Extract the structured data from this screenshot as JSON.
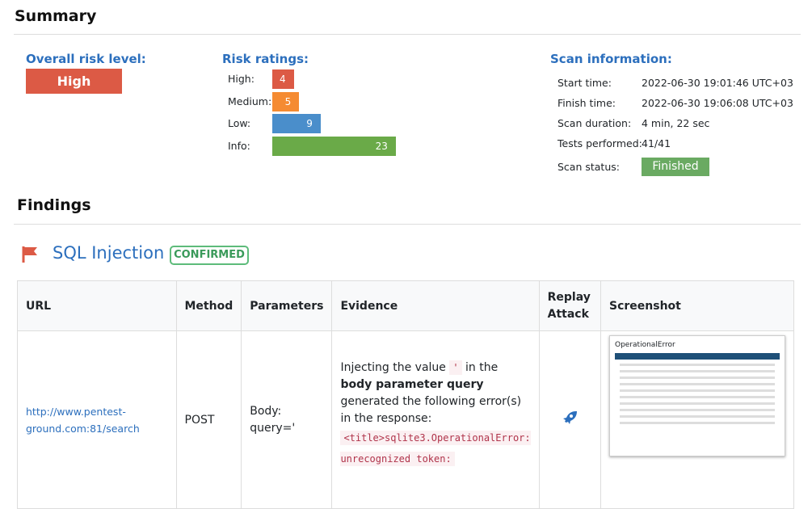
{
  "summary": {
    "title": "Summary",
    "overall_label": "Overall risk level:",
    "overall_value": "High",
    "ratings_label": "Risk ratings:",
    "ratings": [
      {
        "label": "High:",
        "value": 4,
        "color": "#dc5a45"
      },
      {
        "label": "Medium:",
        "value": 5,
        "color": "#f58b32"
      },
      {
        "label": "Low:",
        "value": 9,
        "color": "#4a8ecb"
      },
      {
        "label": "Info:",
        "value": 23,
        "color": "#6aaa48"
      }
    ],
    "scan_label": "Scan information:",
    "scan": [
      {
        "label": "Start time:",
        "value": "2022-06-30 19:01:46 UTC+03"
      },
      {
        "label": "Finish time:",
        "value": "2022-06-30 19:06:08 UTC+03"
      },
      {
        "label": "Scan duration:",
        "value": "4 min, 22 sec"
      },
      {
        "label": "Tests performed:",
        "value": "41/41"
      },
      {
        "label": "Scan status:",
        "value": "Finished"
      }
    ]
  },
  "findings": {
    "title": "Findings",
    "vuln": "SQL Injection",
    "badge": "CONFIRMED",
    "columns": [
      "URL",
      "Method",
      "Parameters",
      "Evidence",
      "Replay Attack",
      "Screenshot"
    ],
    "row": {
      "url": "http://www.pentest-ground.com:81/search",
      "method": "POST",
      "params": "Body: query='",
      "ev1": "Injecting the value ",
      "ev_code": "'",
      "ev2": " in the ",
      "ev_bold": "body parameter query",
      "ev3": " generated the following error(s) in the response:",
      "ev_error": "<title>sqlite3.OperationalError: unrecognized token:",
      "shot_title": "OperationalError"
    }
  }
}
